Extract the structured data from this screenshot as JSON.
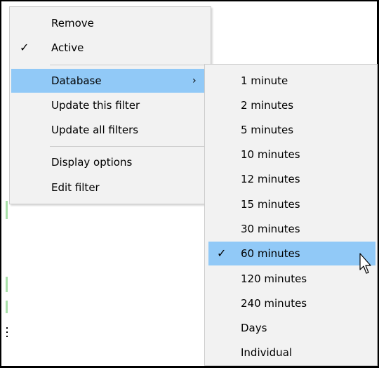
{
  "menu": {
    "items": [
      {
        "label": "Remove",
        "checked": false
      },
      {
        "label": "Active",
        "checked": true
      },
      {
        "label": "Database",
        "has_submenu": true,
        "highlighted": true
      },
      {
        "label": "Update this filter"
      },
      {
        "label": "Update all filters"
      },
      {
        "label": "Display options"
      },
      {
        "label": "Edit filter"
      }
    ],
    "check_icon": "checkmark-icon",
    "submenu_arrow": "›"
  },
  "submenu": {
    "items": [
      {
        "label": "1 minute"
      },
      {
        "label": "2 minutes"
      },
      {
        "label": "5 minutes"
      },
      {
        "label": "10 minutes"
      },
      {
        "label": "12 minutes"
      },
      {
        "label": "15 minutes"
      },
      {
        "label": "30 minutes"
      },
      {
        "label": "60 minutes",
        "checked": true,
        "highlighted": true
      },
      {
        "label": "120 minutes"
      },
      {
        "label": "240 minutes"
      },
      {
        "label": "Days"
      },
      {
        "label": "Individual"
      }
    ]
  },
  "colors": {
    "menu_bg": "#f2f2f2",
    "highlight": "#91c9f7",
    "separator": "#cccccc"
  },
  "glyphs": {
    "check": "✓"
  }
}
